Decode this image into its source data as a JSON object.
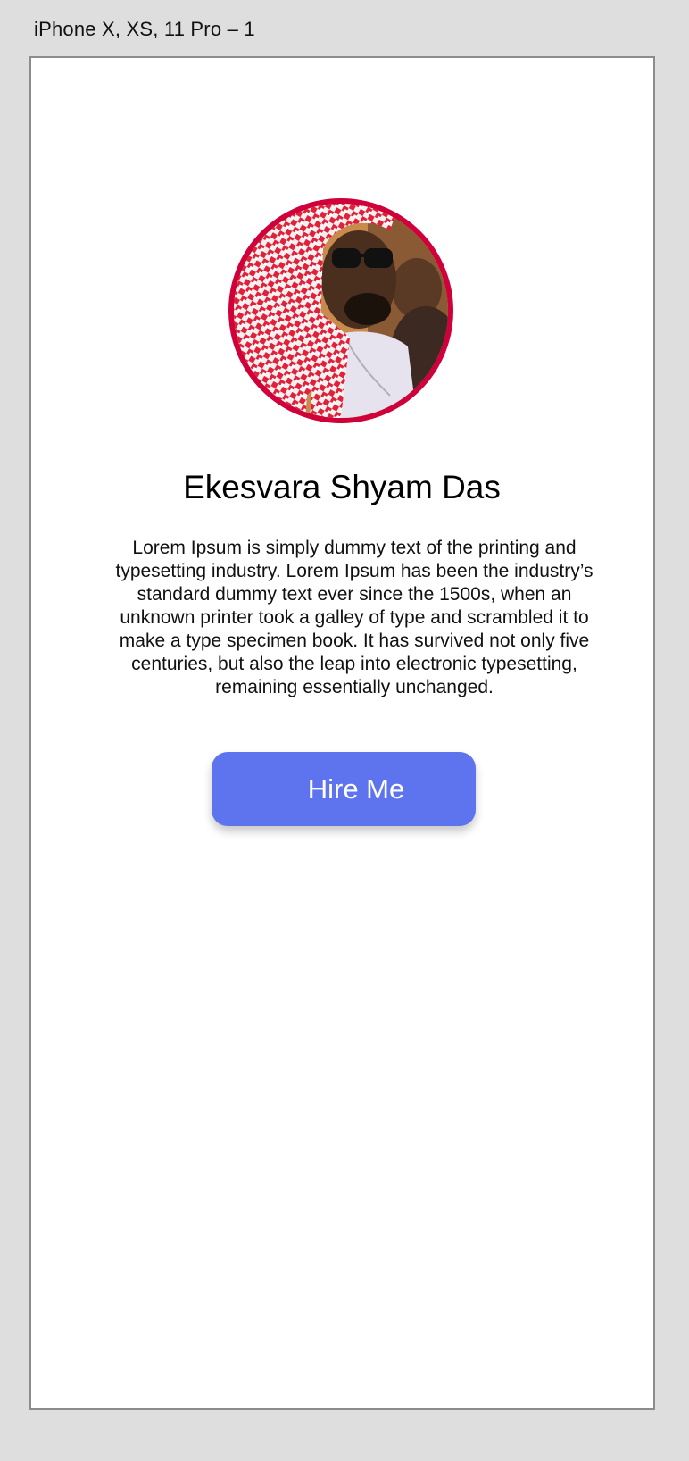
{
  "artboard": {
    "label": "iPhone X, XS, 11 Pro – 1"
  },
  "profile": {
    "name": "Ekesvara Shyam Das",
    "bio": "Lorem Ipsum is simply dummy text of the printing and typesetting industry. Lorem Ipsum has been the industry’s standard dummy text ever since the 1500s, when an unknown printer took a galley of type and scrambled it to make a type specimen book. It has survived not only five centuries, but also the leap into electronic typesetting, remaining essentially unchanged.",
    "avatar_border_color": "#d0003a"
  },
  "actions": {
    "hire_label": "Hire Me",
    "hire_color": "#5e74ee"
  }
}
